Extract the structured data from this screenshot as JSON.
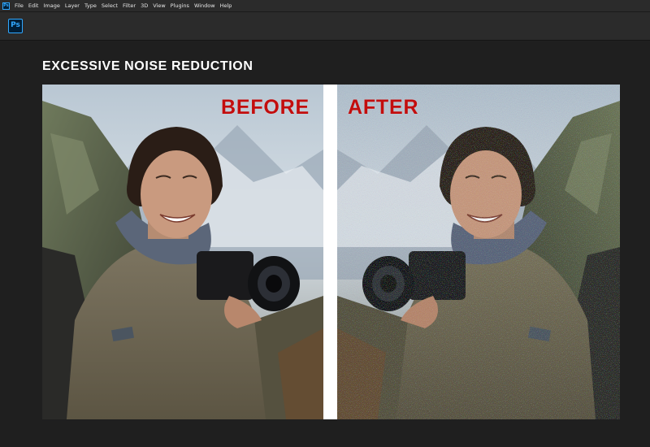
{
  "app": {
    "logo_text": "Ps",
    "menu": [
      "File",
      "Edit",
      "Image",
      "Layer",
      "Type",
      "Select",
      "Filter",
      "3D",
      "View",
      "Plugins",
      "Window",
      "Help"
    ]
  },
  "document": {
    "heading": "EXCESSIVE NOISE REDUCTION",
    "before_label": "BEFORE",
    "after_label": "AFTER"
  },
  "colors": {
    "accent_label": "#c30d0d",
    "ps_blue": "#31a8ff",
    "workspace_bg": "#1f1f1f"
  }
}
